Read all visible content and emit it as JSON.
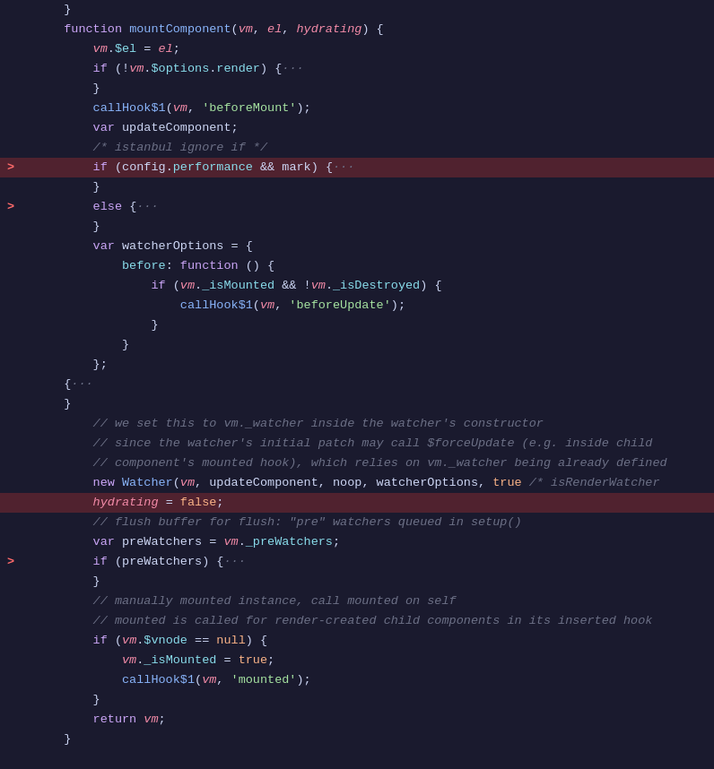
{
  "editor": {
    "background": "#1a1a2e",
    "lines": [
      {
        "id": 1,
        "text": "  }",
        "highlight": false,
        "arrow": false
      },
      {
        "id": 2,
        "text": "  function mountComponent(vm, el, hydrating) {",
        "highlight": false,
        "arrow": false
      },
      {
        "id": 3,
        "text": "      vm.$el = el;",
        "highlight": false,
        "arrow": false
      },
      {
        "id": 4,
        "text": "      if (!vm.$options.render) {···",
        "highlight": false,
        "arrow": false
      },
      {
        "id": 5,
        "text": "      }",
        "highlight": false,
        "arrow": false
      },
      {
        "id": 6,
        "text": "      callHook$1(vm, 'beforeMount');",
        "highlight": false,
        "arrow": false
      },
      {
        "id": 7,
        "text": "      var updateComponent;",
        "highlight": false,
        "arrow": false
      },
      {
        "id": 8,
        "text": "      /* istanbul ignore if */",
        "highlight": false,
        "arrow": false
      },
      {
        "id": 9,
        "text": "      if (config.performance && mark) {···",
        "highlight": true,
        "arrow": true
      },
      {
        "id": 10,
        "text": "      }",
        "highlight": false,
        "arrow": false
      },
      {
        "id": 11,
        "text": "      else {···",
        "highlight": false,
        "arrow": true
      },
      {
        "id": 12,
        "text": "      }",
        "highlight": false,
        "arrow": false
      },
      {
        "id": 13,
        "text": "      var watcherOptions = {",
        "highlight": false,
        "arrow": false
      },
      {
        "id": 14,
        "text": "          before: function () {",
        "highlight": false,
        "arrow": false
      },
      {
        "id": 15,
        "text": "              if (vm._isMounted && !vm._isDestroyed) {",
        "highlight": false,
        "arrow": false
      },
      {
        "id": 16,
        "text": "                  callHook$1(vm, 'beforeUpdate');",
        "highlight": false,
        "arrow": false
      },
      {
        "id": 17,
        "text": "              }",
        "highlight": false,
        "arrow": false
      },
      {
        "id": 18,
        "text": "          }",
        "highlight": false,
        "arrow": false
      },
      {
        "id": 19,
        "text": "      };",
        "highlight": false,
        "arrow": false
      },
      {
        "id": 20,
        "text": "  {···",
        "highlight": false,
        "arrow": false
      },
      {
        "id": 21,
        "text": "  }",
        "highlight": false,
        "arrow": false
      },
      {
        "id": 22,
        "text": "      // we set this to vm._watcher inside the watcher's constructor",
        "highlight": false,
        "arrow": false
      },
      {
        "id": 23,
        "text": "      // since the watcher's initial patch may call $forceUpdate (e.g. inside child",
        "highlight": false,
        "arrow": false
      },
      {
        "id": 24,
        "text": "      // component's mounted hook), which relies on vm._watcher being already defined",
        "highlight": false,
        "arrow": false
      },
      {
        "id": 25,
        "text": "      new Watcher(vm, updateComponent, noop, watcherOptions, true /* isRenderWatcher",
        "highlight": false,
        "arrow": false
      },
      {
        "id": 26,
        "text": "      hydrating = false;",
        "highlight": true,
        "arrow": false
      },
      {
        "id": 27,
        "text": "      // flush buffer for flush: \"pre\" watchers queued in setup()",
        "highlight": false,
        "arrow": false
      },
      {
        "id": 28,
        "text": "      var preWatchers = vm._preWatchers;",
        "highlight": false,
        "arrow": false
      },
      {
        "id": 29,
        "text": "      if (preWatchers) {···",
        "highlight": false,
        "arrow": true
      },
      {
        "id": 30,
        "text": "      }",
        "highlight": false,
        "arrow": false
      },
      {
        "id": 31,
        "text": "      // manually mounted instance, call mounted on self",
        "highlight": false,
        "arrow": false
      },
      {
        "id": 32,
        "text": "      // mounted is called for render-created child components in its inserted hook",
        "highlight": false,
        "arrow": false
      },
      {
        "id": 33,
        "text": "      if (vm.$vnode == null) {",
        "highlight": false,
        "arrow": false
      },
      {
        "id": 34,
        "text": "          vm._isMounted = true;",
        "highlight": false,
        "arrow": false
      },
      {
        "id": 35,
        "text": "          callHook$1(vm, 'mounted');",
        "highlight": false,
        "arrow": false
      },
      {
        "id": 36,
        "text": "      }",
        "highlight": false,
        "arrow": false
      },
      {
        "id": 37,
        "text": "      return vm;",
        "highlight": false,
        "arrow": false
      },
      {
        "id": 38,
        "text": "  }",
        "highlight": false,
        "arrow": false
      }
    ]
  }
}
